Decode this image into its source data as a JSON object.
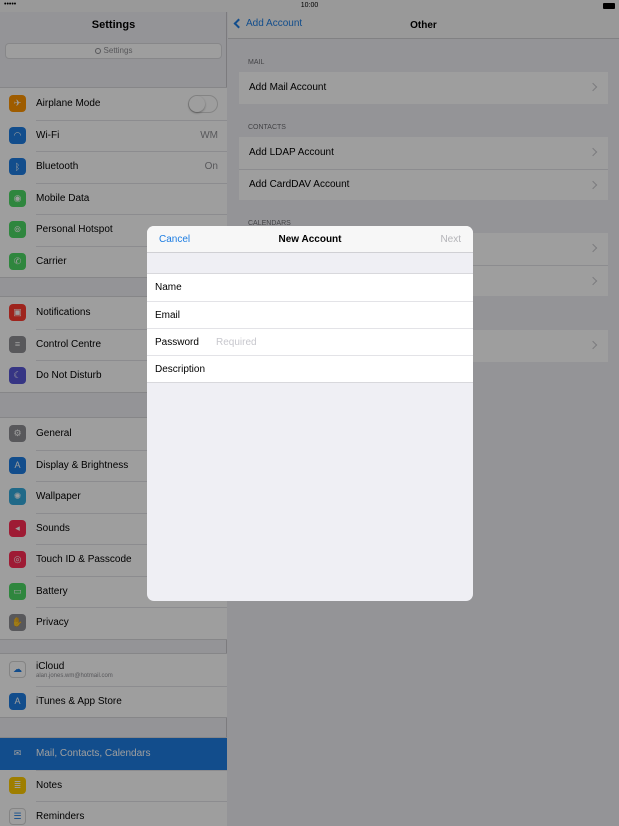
{
  "status": {
    "dots": "•••••",
    "time": "10:00"
  },
  "sidebar": {
    "title": "Settings",
    "search_placeholder": "Settings",
    "groups": [
      [
        {
          "label": "Airplane Mode",
          "icon": "airplane-icon",
          "color": "#ff9500",
          "glyph": "✈",
          "toggle": "off"
        },
        {
          "label": "Wi-Fi",
          "icon": "wifi-icon",
          "color": "#1d7de2",
          "glyph": "◠",
          "value": "WM"
        },
        {
          "label": "Bluetooth",
          "icon": "bluetooth-icon",
          "color": "#1d7de2",
          "glyph": "ᛒ",
          "value": "On"
        },
        {
          "label": "Mobile Data",
          "icon": "antenna-icon",
          "color": "#4cd964",
          "glyph": "◉"
        },
        {
          "label": "Personal Hotspot",
          "icon": "hotspot-icon",
          "color": "#4cd964",
          "glyph": "⊚"
        },
        {
          "label": "Carrier",
          "icon": "phone-icon",
          "color": "#4cd964",
          "glyph": "✆"
        }
      ],
      [
        {
          "label": "Notifications",
          "icon": "notifications-icon",
          "color": "#ff3b30",
          "glyph": "▣"
        },
        {
          "label": "Control Centre",
          "icon": "control-centre-icon",
          "color": "#8e8e93",
          "glyph": "≡"
        },
        {
          "label": "Do Not Disturb",
          "icon": "moon-icon",
          "color": "#5856d6",
          "glyph": "☾"
        }
      ],
      [
        {
          "label": "General",
          "icon": "gear-icon",
          "color": "#8e8e93",
          "glyph": "⚙"
        },
        {
          "label": "Display & Brightness",
          "icon": "display-icon",
          "color": "#1d7de2",
          "glyph": "A"
        },
        {
          "label": "Wallpaper",
          "icon": "wallpaper-icon",
          "color": "#34aadc",
          "glyph": "✺"
        },
        {
          "label": "Sounds",
          "icon": "speaker-icon",
          "color": "#ff2d55",
          "glyph": "◂"
        },
        {
          "label": "Touch ID & Passcode",
          "icon": "fingerprint-icon",
          "color": "#ff2d55",
          "glyph": "◎"
        },
        {
          "label": "Battery",
          "icon": "battery-icon",
          "color": "#4cd964",
          "glyph": "▭"
        },
        {
          "label": "Privacy",
          "icon": "hand-icon",
          "color": "#8e8e93",
          "glyph": "✋"
        }
      ],
      [
        {
          "label": "iCloud",
          "sub": "alan.jones.wm@hotmail.com",
          "icon": "cloud-icon",
          "color": "#ffffff",
          "glyph": "☁"
        },
        {
          "label": "iTunes & App Store",
          "icon": "app-store-icon",
          "color": "#1d7de2",
          "glyph": "A"
        }
      ],
      [
        {
          "label": "Mail, Contacts, Calendars",
          "icon": "mail-icon",
          "color": "#1d7de2",
          "glyph": "✉",
          "selected": true
        },
        {
          "label": "Notes",
          "icon": "notes-icon",
          "color": "#ffcc00",
          "glyph": "≣"
        },
        {
          "label": "Reminders",
          "icon": "reminders-icon",
          "color": "#ffffff",
          "glyph": "☰"
        }
      ]
    ]
  },
  "main": {
    "back_label": "Add Account",
    "title": "Other",
    "mail_header": "MAIL",
    "mail_rows": [
      "Add Mail Account"
    ],
    "contacts_header": "CONTACTS",
    "contacts_rows": [
      "Add LDAP Account",
      "Add CardDAV Account"
    ],
    "calendars_header": "CALENDARS"
  },
  "modal": {
    "cancel": "Cancel",
    "title": "New Account",
    "next": "Next",
    "fields": [
      {
        "label": "Name",
        "value": "",
        "placeholder": ""
      },
      {
        "label": "Email",
        "value": "",
        "placeholder": ""
      },
      {
        "label": "Password",
        "value": "",
        "placeholder": "Required"
      },
      {
        "label": "Description",
        "value": "",
        "placeholder": ""
      }
    ]
  }
}
